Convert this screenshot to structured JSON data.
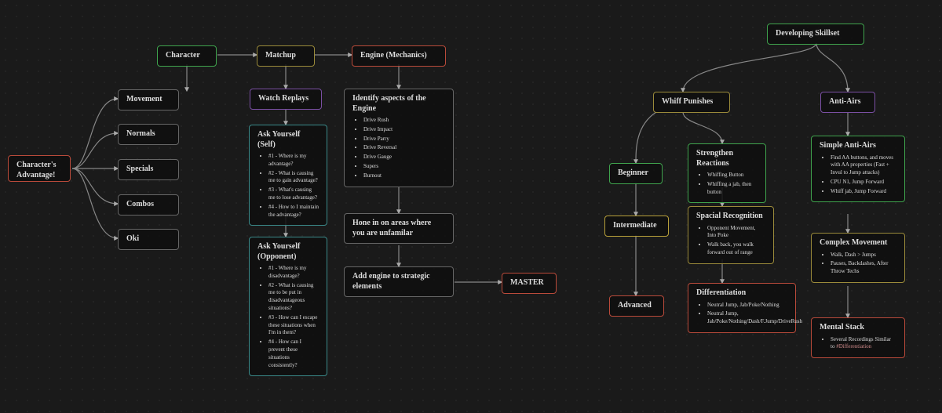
{
  "root": "Character's Advantage!",
  "character": {
    "label": "Character",
    "children": [
      "Movement",
      "Normals",
      "Specials",
      "Combos",
      "Oki"
    ]
  },
  "matchup": {
    "label": "Matchup",
    "watch": "Watch Replays",
    "askSelf": {
      "title": "Ask Yourself (Self)",
      "items": [
        "#1 - Where is my advantage?",
        "#2 - What is causing me to gain advantage?",
        "#3 - What's causing me to lose advantage?",
        "#4 - How to I maintain the advantage?"
      ]
    },
    "askOpp": {
      "title": "Ask Yourself (Opponent)",
      "items": [
        "#1 - Where is my disadvantage?",
        "#2 - What is causing me to be put in disadvantageous situations?",
        "#3 - How can I escape these situations when I'm in them?",
        "#4 - How can I prevent these situations consistently?"
      ]
    }
  },
  "engine": {
    "label": "Engine (Mechanics)",
    "identify": {
      "title": "Identify aspects of the Engine",
      "items": [
        "Drive Rush",
        "Drive Impact",
        "Drive Parry",
        "Drive Reversal",
        "Drive Gauge",
        "Supers",
        "Burnout"
      ]
    },
    "hone": "Hone in on areas where you are unfamilar",
    "add": "Add engine to strategic elements",
    "master": "MASTER"
  },
  "skillset": {
    "label": "Developing Skillset",
    "whiff": {
      "label": "Whiff Punishes",
      "levels": [
        "Beginner",
        "Intermediate",
        "Advanced"
      ],
      "strengthen": {
        "title": "Strengthen Reactions",
        "items": [
          "Whiffing Button",
          "Whiffing a jab, then button"
        ]
      },
      "spacial": {
        "title": "Spacial Recognition",
        "items": [
          "Opponent Movement, Into Poke",
          "Walk back, you walk forward out of range"
        ]
      },
      "diff": {
        "title": "Differentiation",
        "items": [
          "Neutral Jump, Jab/Poke/Nothing",
          "Neutral Jump, Jab/Poke/Nothing/Dash/F.Jump/DriveRush"
        ]
      }
    },
    "antiairs": {
      "label": "Anti-Airs",
      "simple": {
        "title": "Simple Anti-Airs",
        "items": [
          "Find AA buttons, and moves with AA properties (Fast + Invul to Jump attacks)",
          "CPU N1, Jump Forward",
          "Whiff jab, Jump Forward"
        ]
      },
      "complex": {
        "title": "Complex Movement",
        "items": [
          "Walk, Dash > Jumps",
          "Pauses, Backdashes, After Throw Techs"
        ]
      },
      "mental": {
        "title": "Mental Stack",
        "text": "Several Recordings Similar to ",
        "link": "#Differentiation"
      }
    }
  }
}
